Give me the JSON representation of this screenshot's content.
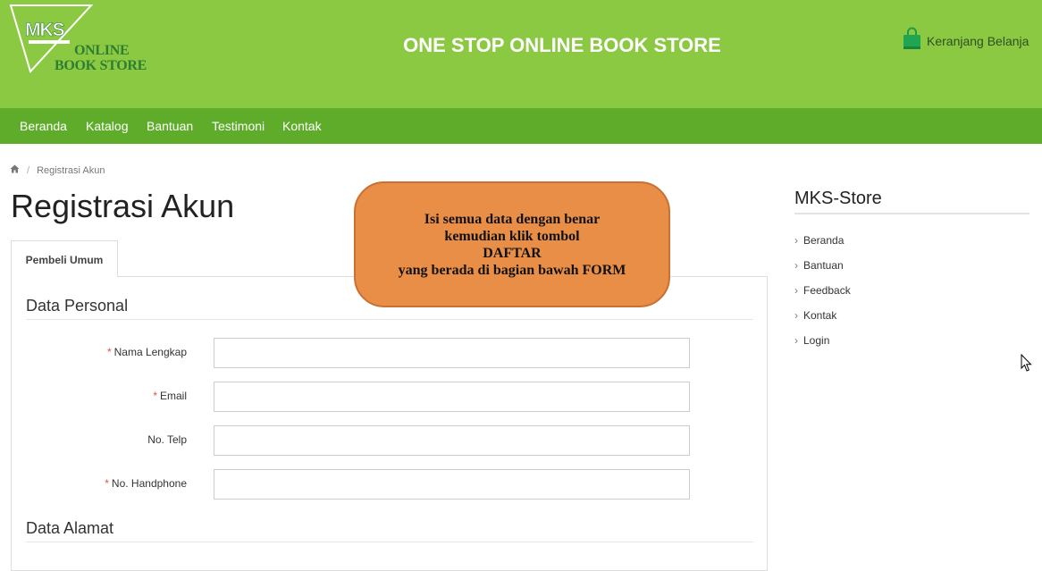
{
  "header": {
    "logo": {
      "mark": "MKS",
      "line1": "ONLINE",
      "line2": "BOOK STORE"
    },
    "title": "ONE STOP ONLINE BOOK STORE",
    "cart_label": "Keranjang Belanja",
    "cart_icon": "shopping-bag-icon"
  },
  "nav": {
    "items": [
      "Beranda",
      "Katalog",
      "Bantuan",
      "Testimoni",
      "Kontak"
    ]
  },
  "breadcrumb": {
    "home_icon": "home-icon",
    "current": "Registrasi Akun"
  },
  "page": {
    "title": "Registrasi Akun",
    "tab": "Pembeli Umum"
  },
  "form": {
    "section_personal": "Data Personal",
    "section_address": "Data Alamat",
    "fields": [
      {
        "label": "Nama Lengkap",
        "required": "*",
        "value": ""
      },
      {
        "label": "Email",
        "required": "*",
        "value": ""
      },
      {
        "label": "No. Telp",
        "required": "",
        "value": ""
      },
      {
        "label": "No. Handphone",
        "required": "*",
        "value": ""
      }
    ]
  },
  "callout": {
    "lines": [
      "Isi semua data dengan benar",
      "kemudian klik tombol",
      "DAFTAR",
      "yang berada di bagian bawah FORM"
    ]
  },
  "sidebar": {
    "title": "MKS-Store",
    "items": [
      "Beranda",
      "Bantuan",
      "Feedback",
      "Kontak",
      "Login"
    ]
  },
  "colors": {
    "header_green": "#8cc943",
    "nav_green": "#5fac2b",
    "callout_orange": "#e98e47",
    "required_red": "#d9534f"
  }
}
